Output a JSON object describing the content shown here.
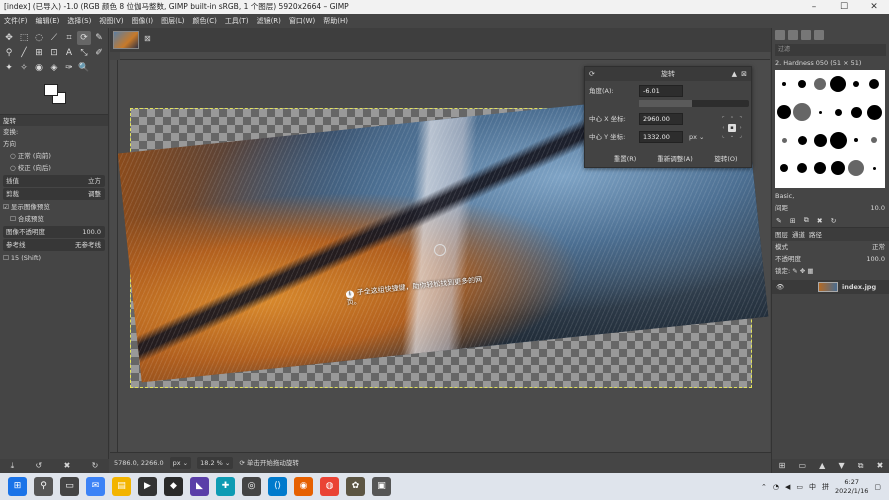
{
  "window": {
    "title": "[index] (已导入) -1.0 (RGB 颜色 8 位伽马整数, GIMP built-in sRGB, 1 个图层) 5920x2664 – GIMP",
    "min": "–",
    "max": "☐",
    "close": "✕"
  },
  "menu": [
    "文件(F)",
    "编辑(E)",
    "选择(S)",
    "视图(V)",
    "图像(I)",
    "图层(L)",
    "颜色(C)",
    "工具(T)",
    "滤镜(R)",
    "窗口(W)",
    "帮助(H)"
  ],
  "toolbox": {
    "tools": [
      "✥",
      "⬚",
      "◌",
      "⟋",
      "⌗",
      "⟳",
      "✎",
      "⚲",
      "╱",
      "⊞",
      "⊡",
      "A",
      "⤡",
      "✐",
      "✦",
      "✧",
      "◉",
      "◈",
      "✑",
      "🔍"
    ],
    "options": {
      "header": "旋转",
      "transform_label": "变换:",
      "direction_label": "方向",
      "direction_normal": "正常 (向前)",
      "direction_corrective": "校正 (向后)",
      "interpolation_label": "插值",
      "interpolation_value": "立方",
      "clipping_label": "剪裁",
      "clipping_value": "调整",
      "show_preview": "显示图像预览",
      "composited_preview": "合成预览",
      "preview_opacity_label": "图像不透明度",
      "preview_opacity_value": "100.0",
      "guides_label": "参考线",
      "guides_value": "无参考线",
      "shift_hint": "15 (Shift)"
    },
    "bottom_icons": [
      "⤓",
      "↺",
      "✖",
      "↻"
    ]
  },
  "canvas": {
    "tooltip": "子全这组快捷键，助你轻松找到更多的网页。",
    "status_coords": "5786.0, 2266.0",
    "status_unit": "px",
    "status_zoom": "18.2 %",
    "status_msg": "单击开始拖动旋转"
  },
  "dialog": {
    "title": "旋转",
    "angle_label": "角度(A):",
    "angle_value": "-6.01",
    "center_x_label": "中心 X 坐标:",
    "center_x_value": "2960.00",
    "center_y_label": "中心 Y 坐标:",
    "center_y_value": "1332.00",
    "unit": "px",
    "reset_btn": "重置(R)",
    "readjust_btn": "重新调整(A)",
    "rotate_btn": "旋转(O)",
    "angle_fill": 0.48
  },
  "right_panel": {
    "filter_placeholder": "过滤",
    "brush_name": "2. Hardness 050 (51 × 51)",
    "brush_set": "Basic,",
    "spacing_label": "间距",
    "spacing_value": "10.0",
    "layer_tabs": [
      "图层",
      "通道",
      "路径"
    ],
    "mode_label": "模式",
    "mode_value": "正常",
    "opacity_label": "不透明度",
    "opacity_value": "100.0",
    "lock_label": "锁定:",
    "layer_name": "index.jpg"
  },
  "taskbar": {
    "time": "6:27",
    "date": "2022/1/16",
    "ime": "中",
    "ime2": "拼"
  }
}
